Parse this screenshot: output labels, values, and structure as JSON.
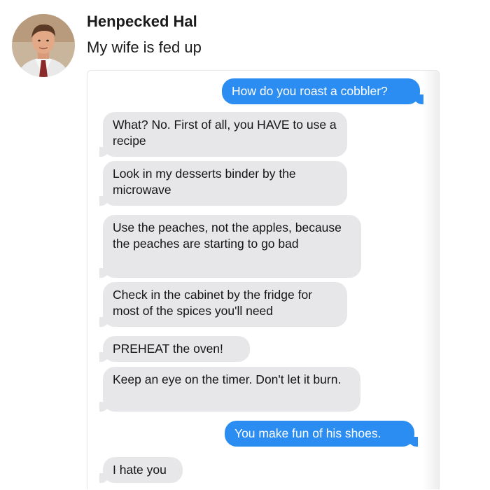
{
  "post": {
    "author": "Henpecked Hal",
    "caption": "My wife is fed up"
  },
  "colors": {
    "sent_bubble": "#2b8df2",
    "received_bubble": "#e7e7ea"
  },
  "messages": [
    {
      "direction": "sent",
      "text": "How do you roast a cobbler?"
    },
    {
      "direction": "received",
      "text": "What? No. First of all, you HAVE to use a recipe"
    },
    {
      "direction": "received",
      "text": "Look in my desserts binder by the microwave"
    },
    {
      "direction": "received",
      "text": "Use the peaches, not the apples, because the peaches are starting to go bad"
    },
    {
      "direction": "received",
      "text": "Check in the cabinet by the fridge for most of the spices you'll need"
    },
    {
      "direction": "received",
      "text": "PREHEAT the oven!"
    },
    {
      "direction": "received",
      "text": "Keep an eye on the timer. Don't let it burn."
    },
    {
      "direction": "sent",
      "text": "You make fun of his shoes."
    },
    {
      "direction": "received",
      "text": "I hate you"
    }
  ]
}
